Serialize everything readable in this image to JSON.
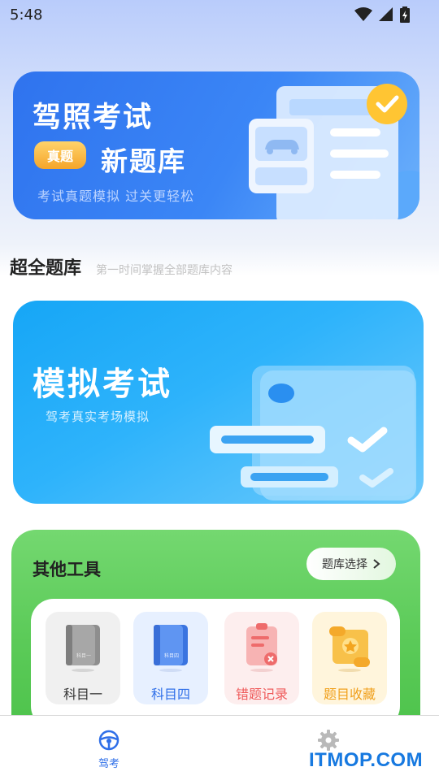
{
  "status_bar": {
    "time": "5:48"
  },
  "banner": {
    "title": "驾照考试",
    "badge": "真题",
    "subtitle": "新题库",
    "caption": "考试真题模拟  过关更轻松"
  },
  "section": {
    "title": "超全题库",
    "caption": "第一时间掌握全部题库内容"
  },
  "exam_card": {
    "title": "模拟考试",
    "caption": "驾考真实考场模拟"
  },
  "tools": {
    "title": "其他工具",
    "select_button": "题库选择",
    "items": [
      {
        "label": "科目一",
        "book_text": "科目一",
        "icon": "book-icon",
        "color": "#f0f0f0",
        "label_color": "#333333"
      },
      {
        "label": "科目四",
        "book_text": "科目四",
        "icon": "book-icon",
        "color": "#e7f0ff",
        "label_color": "#2f6fe8"
      },
      {
        "label": "错题记录",
        "icon": "clipboard-icon",
        "color": "#fdeeee",
        "label_color": "#ef5a5a"
      },
      {
        "label": "题目收藏",
        "icon": "scroll-star-icon",
        "color": "#fff5dc",
        "label_color": "#f0a01c"
      }
    ]
  },
  "nav": {
    "items": [
      {
        "label": "驾考",
        "icon": "steering-wheel-icon",
        "active": true
      },
      {
        "label": "",
        "icon": "gear-icon",
        "active": false
      }
    ]
  },
  "watermark": "ITMOP.COM",
  "colors": {
    "accent": "#2f6fe8",
    "green": "#5ccb59",
    "sky": "#2eb3fb"
  }
}
